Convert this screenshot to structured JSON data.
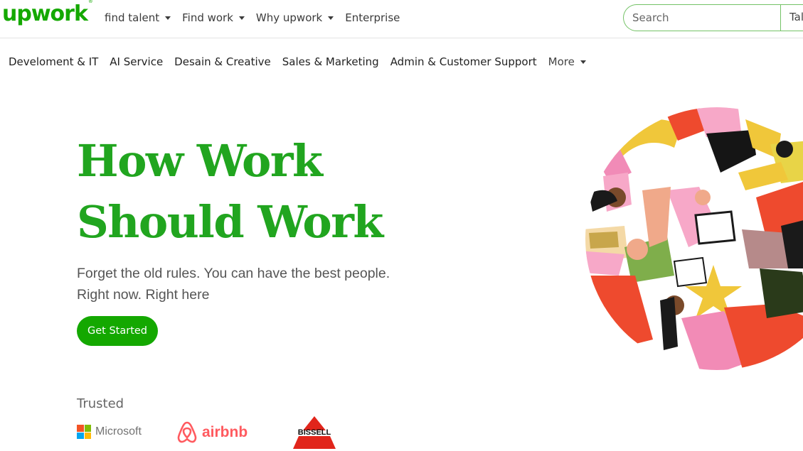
{
  "header": {
    "logo": "upwork",
    "nav": [
      {
        "label": "find talent",
        "dropdown": true
      },
      {
        "label": "Find work",
        "dropdown": true
      },
      {
        "label": "Why upwork",
        "dropdown": true
      },
      {
        "label": "Enterprise",
        "dropdown": false
      }
    ],
    "search_placeholder": "Search",
    "search_type": "Talent"
  },
  "categories": [
    "Develoment & IT",
    "AI Service",
    "Desain & Creative",
    "Sales & Marketing",
    "Admin & Customer Support"
  ],
  "more_label": "More",
  "hero": {
    "title_line1": "How Work",
    "title_line2": "Should Work",
    "sub_line1": "Forget the old rules. You can have the best people.",
    "sub_line2": "Right now. Right here",
    "cta": "Get Started"
  },
  "trusted": {
    "label": "Trusted",
    "logos": {
      "microsoft": "Microsoft",
      "airbnb": "airbnb",
      "bissell": "BISSELL"
    }
  },
  "colors": {
    "brand_green": "#14a800",
    "title_green": "#21a51f",
    "airbnb": "#ff5a5f",
    "bissell": "#e1251b"
  }
}
